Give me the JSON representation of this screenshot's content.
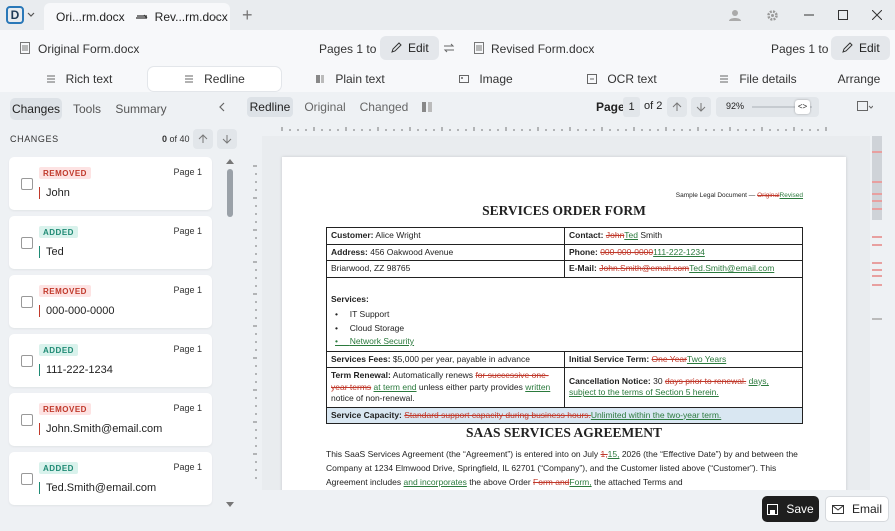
{
  "tabs": {
    "tab1_label": "Ori...rm.docx",
    "tab2_label": "Rev...rm.docx",
    "close": "×",
    "add": "+"
  },
  "header": {
    "original_name": "Original Form.docx",
    "original_pages": "Pages 1 to 2",
    "edit_label": "Edit",
    "revised_name": "Revised Form.docx",
    "revised_pages": "Pages 1 to 2",
    "edit2_label": "Edit"
  },
  "view_tabs": [
    "Rich text",
    "Redline",
    "Plain text",
    "Image",
    "OCR text",
    "File details"
  ],
  "arrange_label": "Arrange",
  "left": {
    "tabs": [
      "Changes",
      "Tools",
      "Summary"
    ],
    "changes_title": "CHANGES",
    "count_current": "0",
    "count_total": "of 40",
    "items": [
      {
        "badge": "REMOVED",
        "page": "Page 1",
        "value": "John"
      },
      {
        "badge": "ADDED",
        "page": "Page 1",
        "value": "Ted"
      },
      {
        "badge": "REMOVED",
        "page": "Page 1",
        "value": "000-000-0000"
      },
      {
        "badge": "ADDED",
        "page": "Page 1",
        "value": "111-222-1234"
      },
      {
        "badge": "REMOVED",
        "page": "Page 1",
        "value": "John.Smith@email.com"
      },
      {
        "badge": "ADDED",
        "page": "Page 1",
        "value": "Ted.Smith@email.com"
      }
    ]
  },
  "main": {
    "tabs": [
      "Redline",
      "Original",
      "Changed"
    ],
    "page_label": "Page",
    "page_value": "1",
    "page_of": "of 2",
    "zoom": "92%"
  },
  "doc": {
    "header_prefix": "Sample Legal Document —",
    "header_del": "Original",
    "header_ins": "Revised",
    "title": "SERVICES ORDER FORM",
    "customer_label": "Customer:",
    "customer_value": "Alice Wright",
    "contact_label": "Contact:",
    "contact_del": "John",
    "contact_ins": "Ted",
    "contact_tail": " Smith",
    "address_label": "Address:",
    "address_value": "456 Oakwood Avenue",
    "phone_label": "Phone:",
    "phone_del": "000-000-0000",
    "phone_ins": "111-222-1234",
    "city": "Briarwood, ZZ 98765",
    "email_label": "E-Mail:",
    "email_del": "John.Smith@email.com",
    "email_ins": "Ted.Smith@email.com",
    "services_label": "Services:",
    "services": [
      "IT Support",
      "Cloud Storage"
    ],
    "services_ins": "Network Security",
    "fees_label": "Services Fees:",
    "fees_value": "$5,000 per year, payable in advance",
    "term_label": "Initial Service Term:",
    "term_del": "One Year",
    "term_ins": "Two Years",
    "renewal_label": "Term Renewal:",
    "renewal_a": "Automatically renews",
    "renewal_del": "for successive one-year terms",
    "renewal_ins": "at term end",
    "renewal_b": "unless either party provides",
    "renewal_ins2": "written",
    "renewal_c": "notice of non-renewal.",
    "cancel_label": "Cancellation Notice:",
    "cancel_a": "30",
    "cancel_del": "days prior to renewal.",
    "cancel_ins": "days,",
    "cancel_ins2": "subject to the terms of Section 5 herein.",
    "capacity_label": "Service Capacity:",
    "capacity_del": "Standard support capacity during business hours.",
    "capacity_ins": "Unlimited within the two-year term.",
    "agreement_title": "SAAS SERVICES AGREEMENT",
    "para_a": "This SaaS Services Agreement (the “Agreement”) is entered into on July",
    "para_del1": "1,",
    "para_ins1": "15,",
    "para_b": "2026 (the “Effective Date”) by and between the Company at 1234 Elmwood Drive, Springfield, IL 62701 (“Company”), and the Customer listed above (“Customer”). This Agreement includes",
    "para_ins2": "and incorporates",
    "para_c": "the above Order",
    "para_del2": "Form and",
    "para_ins3": "Form,",
    "para_d": "the attached Terms and"
  },
  "bottom": {
    "save_label": "Save",
    "email_label": "Email"
  }
}
